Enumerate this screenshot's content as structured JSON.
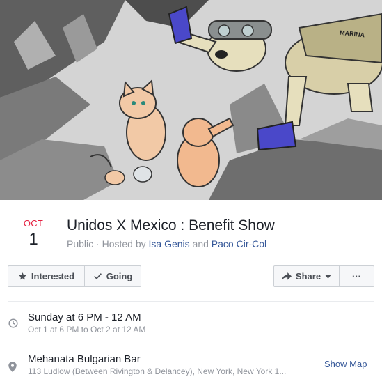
{
  "event": {
    "month": "OCT",
    "day": "1",
    "title": "Unidos X Mexico : Benefit Show",
    "privacy": "Public",
    "hosted_by_prefix": " · Hosted by ",
    "host1": "Isa Genis",
    "and": " and ",
    "host2": "Paco Cir-Col",
    "cover_vest_text": "MARINA"
  },
  "actions": {
    "interested": "Interested",
    "going": "Going",
    "share": "Share",
    "more": "···"
  },
  "details": {
    "time_primary": "Sunday at 6 PM - 12 AM",
    "time_secondary": "Oct 1 at 6 PM to Oct 2 at 12 AM",
    "place_primary": "Mehanata Bulgarian Bar",
    "place_secondary": "113 Ludlow (Between Rivington & Delancey), New York, New York 1...",
    "show_map": "Show Map"
  },
  "colors": {
    "date_month": "#e41e3f",
    "link": "#365899",
    "muted": "#90949c",
    "button_bg": "#f6f7f9",
    "boots": "#4a48c9"
  },
  "icons": {
    "interested": "star-icon",
    "going": "checkmark-icon",
    "share": "share-arrow-icon",
    "share_caret": "caret-down-icon",
    "time": "clock-icon",
    "place": "map-pin-icon"
  }
}
